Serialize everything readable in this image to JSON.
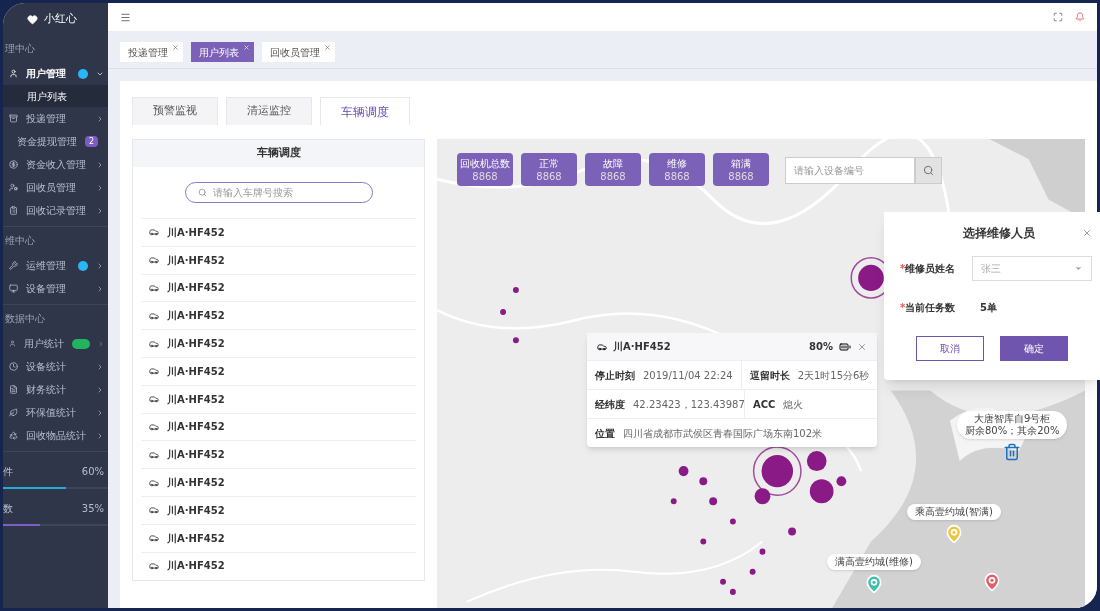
{
  "brand": {
    "name": "小红心"
  },
  "sidebar": {
    "groups": [
      {
        "heading": "理中心",
        "items": [
          {
            "label": "用户管理",
            "expanded": true,
            "badge": {
              "kind": "dot"
            },
            "children": [
              {
                "label": "用户列表",
                "selected": true
              }
            ]
          },
          {
            "label": "投递管理",
            "expanded": false
          },
          {
            "label": "资金提现管理",
            "expanded": false,
            "badge": {
              "kind": "count",
              "text": "2"
            }
          },
          {
            "label": "资金收入管理",
            "expanded": false
          },
          {
            "label": "回收员管理",
            "expanded": false
          },
          {
            "label": "回收记录管理",
            "expanded": false
          }
        ]
      },
      {
        "heading": "维中心",
        "items": [
          {
            "label": "运维管理",
            "expanded": false,
            "badge": {
              "kind": "dot"
            }
          },
          {
            "label": "设备管理",
            "expanded": false
          }
        ]
      },
      {
        "heading": "数据中心",
        "items": [
          {
            "label": "用户统计",
            "expanded": false,
            "badge": {
              "kind": "pill"
            }
          },
          {
            "label": "设备统计",
            "expanded": false
          },
          {
            "label": "财务统计",
            "expanded": false
          },
          {
            "label": "环保值统计",
            "expanded": false
          },
          {
            "label": "回收物品统计",
            "expanded": false
          }
        ]
      }
    ],
    "meters": [
      {
        "label": "件",
        "reading": "60%",
        "level": 0.6,
        "color": "#2aa8d8"
      },
      {
        "label": "数",
        "reading": "35%",
        "level": 0.35,
        "color": "#7d5fc6"
      }
    ]
  },
  "page_tabs": [
    {
      "label": "投递管理",
      "selected": false
    },
    {
      "label": "用户列表",
      "selected": true
    },
    {
      "label": "回收员管理",
      "selected": false
    }
  ],
  "view_tabs": [
    {
      "label": "预警监视",
      "selected": false
    },
    {
      "label": "清运监控",
      "selected": false
    },
    {
      "label": "车辆调度",
      "selected": true
    }
  ],
  "vehicle_panel": {
    "title": "车辆调度",
    "search": {
      "placeholder": "请输入车牌号搜索"
    },
    "vehicles": [
      "川A·HF452",
      "川A·HF452",
      "川A·HF452",
      "川A·HF452",
      "川A·HF452",
      "川A·HF452",
      "川A·HF452",
      "川A·HF452",
      "川A·HF452",
      "川A·HF452",
      "川A·HF452",
      "川A·HF452",
      "川A·HF452"
    ]
  },
  "map": {
    "stats": [
      {
        "label": "回收机总数",
        "value": "8868"
      },
      {
        "label": "正常",
        "value": "8868"
      },
      {
        "label": "故障",
        "value": "8868"
      },
      {
        "label": "维修",
        "value": "8868"
      },
      {
        "label": "箱满",
        "value": "8868"
      }
    ],
    "device_search": {
      "placeholder": "请输入设备编号"
    },
    "vehicle_popup": {
      "plate": "川A·HF452",
      "battery": "80%",
      "rows": [
        [
          {
            "label": "停止时刻",
            "value": "2019/11/04 22:24"
          },
          {
            "label": "逗留时长",
            "value": "2天1时15分6秒"
          }
        ],
        [
          {
            "label": "经纬度",
            "value": "42.23423，123.43987"
          },
          {
            "label": "ACC",
            "value": "熄火"
          }
        ],
        [
          {
            "label": "位置",
            "value": "四川省成都市武侯区青春国际广场东南102米"
          }
        ]
      ]
    },
    "markers": [
      {
        "kind": "bin",
        "lines": [
          "大唐智库自9号柜",
          "厨余80%；其余20%"
        ]
      },
      {
        "kind": "pin",
        "color": "#efc53f",
        "lines": [
          "乘高壹约城(智满)"
        ]
      },
      {
        "kind": "pin",
        "color": "#3fbfae",
        "lines": [
          "满高壹约城(维修)"
        ]
      },
      {
        "kind": "pin",
        "color": "#e2606a"
      }
    ]
  },
  "repair_dialog": {
    "title": "选择维修人员",
    "fields": [
      {
        "label": "维修员姓名",
        "required_mark": "*",
        "kind": "select",
        "value": "张三"
      },
      {
        "label": "当前任务数",
        "required_mark": "*",
        "kind": "text",
        "value": "5单"
      }
    ],
    "buttons": [
      {
        "label": "取消",
        "kind": "secondary"
      },
      {
        "label": "确定",
        "kind": "primary"
      }
    ]
  }
}
